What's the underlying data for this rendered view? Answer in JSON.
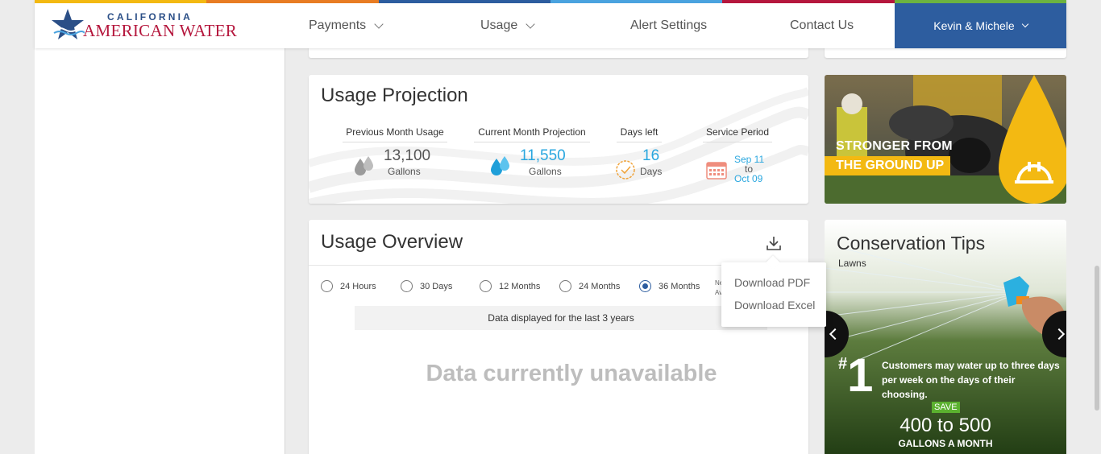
{
  "brand": {
    "line1": "CALIFORNIA",
    "line2": "AMERICAN WATER"
  },
  "nav": {
    "payments": "Payments",
    "usage": "Usage",
    "alerts": "Alert Settings",
    "contact": "Contact Us",
    "user": "Kevin & Michele"
  },
  "colors": {
    "stripe": [
      "#f3b912",
      "#e87c23",
      "#2d5d9f",
      "#4aa3df",
      "#b5173d",
      "#6cb33f"
    ],
    "accent_blue": "#2aa7df",
    "user_menu": "#2d5d9f"
  },
  "projection": {
    "title": "Usage Projection",
    "prev": {
      "label": "Previous Month Usage",
      "value": "13,100",
      "unit": "Gallons",
      "icon": "water-drops-icon"
    },
    "current": {
      "label": "Current Month Projection",
      "value": "11,550",
      "unit": "Gallons",
      "icon": "water-drops-icon"
    },
    "days": {
      "label": "Days left",
      "value": "16",
      "unit": "Days",
      "icon": "clock-icon"
    },
    "period": {
      "label": "Service Period",
      "from": "Sep 11",
      "to": "to",
      "end": "Oct 09",
      "icon": "calendar-icon"
    }
  },
  "overview": {
    "title": "Usage Overview",
    "ranges": [
      {
        "label": "24 Hours",
        "checked": false
      },
      {
        "label": "30 Days",
        "checked": false
      },
      {
        "label": "12 Months",
        "checked": false
      },
      {
        "label": "24 Months",
        "checked": false
      },
      {
        "label": "36 Months",
        "checked": true
      }
    ],
    "cut_off": "Ne\nAv",
    "info": "Data displayed for the last 3 years",
    "unavailable": "Data currently unavailable",
    "download_menu": [
      "Download PDF",
      "Download Excel"
    ]
  },
  "promo": {
    "line1": "STRONGER FROM",
    "line2": "THE GROUND UP"
  },
  "tips": {
    "title": "Conservation Tips",
    "subtitle": "Lawns",
    "number_prefix": "#",
    "number": "1",
    "text": "Customers may water up to three days per week on the days of their choosing.",
    "save": "SAVE",
    "range": "400 to 500",
    "per": "GALLONS A MONTH"
  }
}
